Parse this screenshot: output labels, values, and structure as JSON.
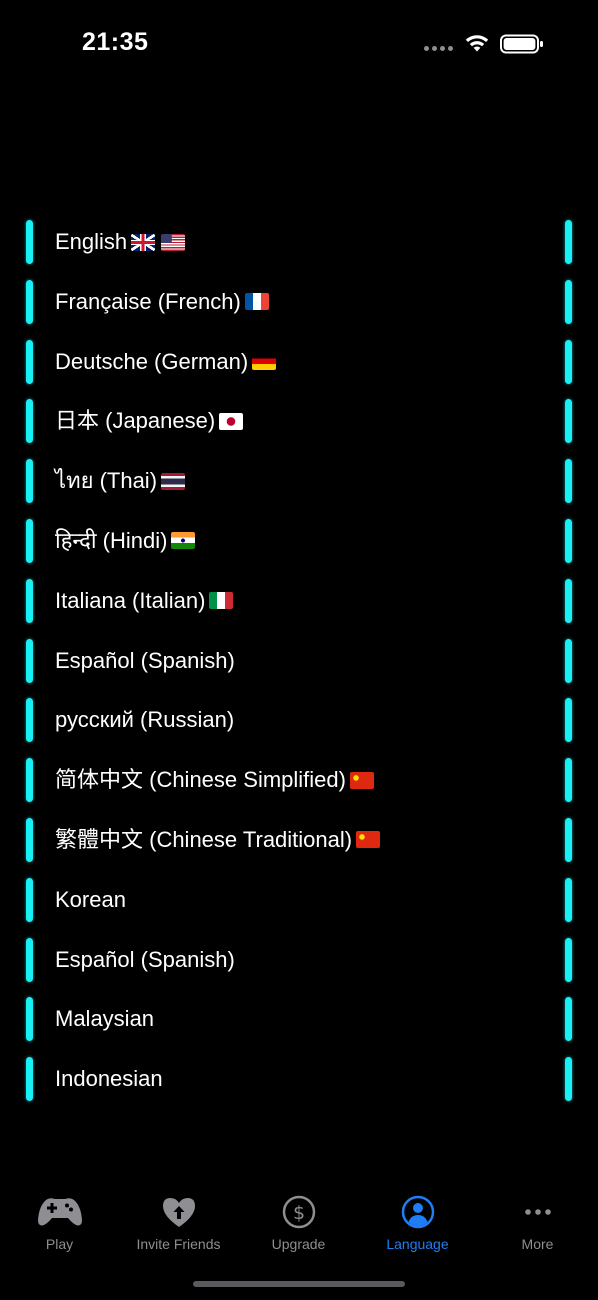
{
  "status_bar": {
    "time": "21:35"
  },
  "languages": [
    {
      "label": "English",
      "flags": [
        "uk",
        "us"
      ]
    },
    {
      "label": "Française (French)",
      "flags": [
        "fr"
      ]
    },
    {
      "label": "Deutsche (German)",
      "flags": [
        "de"
      ]
    },
    {
      "label": "日本 (Japanese)",
      "flags": [
        "jp"
      ]
    },
    {
      "label": "ไทย (Thai)",
      "flags": [
        "th"
      ]
    },
    {
      "label": "हिन्दी (Hindi)",
      "flags": [
        "in"
      ]
    },
    {
      "label": "Italiana (Italian)",
      "flags": [
        "it"
      ]
    },
    {
      "label": "Español (Spanish)",
      "flags": []
    },
    {
      "label": "русский (Russian)",
      "flags": []
    },
    {
      "label": "简体中文 (Chinese Simplified)",
      "flags": [
        "cn"
      ]
    },
    {
      "label": "繁體中文 (Chinese Traditional)",
      "flags": [
        "cn"
      ]
    },
    {
      "label": "Korean",
      "flags": []
    },
    {
      "label": "Español (Spanish)",
      "flags": []
    },
    {
      "label": "Malaysian",
      "flags": []
    },
    {
      "label": "Indonesian",
      "flags": []
    }
  ],
  "tab_bar": {
    "tabs": [
      {
        "label": "Play",
        "icon": "gamepad-icon",
        "active": false
      },
      {
        "label": "Invite Friends",
        "icon": "heart-arrow-icon",
        "active": false
      },
      {
        "label": "Upgrade",
        "icon": "dollar-circle-icon",
        "active": false
      },
      {
        "label": "Language",
        "icon": "person-circle-icon",
        "active": true
      },
      {
        "label": "More",
        "icon": "more-dots-icon",
        "active": false
      }
    ]
  },
  "colors": {
    "accent_bar": "#19f0f5",
    "tab_active": "#1f7ef5",
    "tab_inactive": "#8e8e93",
    "background": "#000000"
  }
}
